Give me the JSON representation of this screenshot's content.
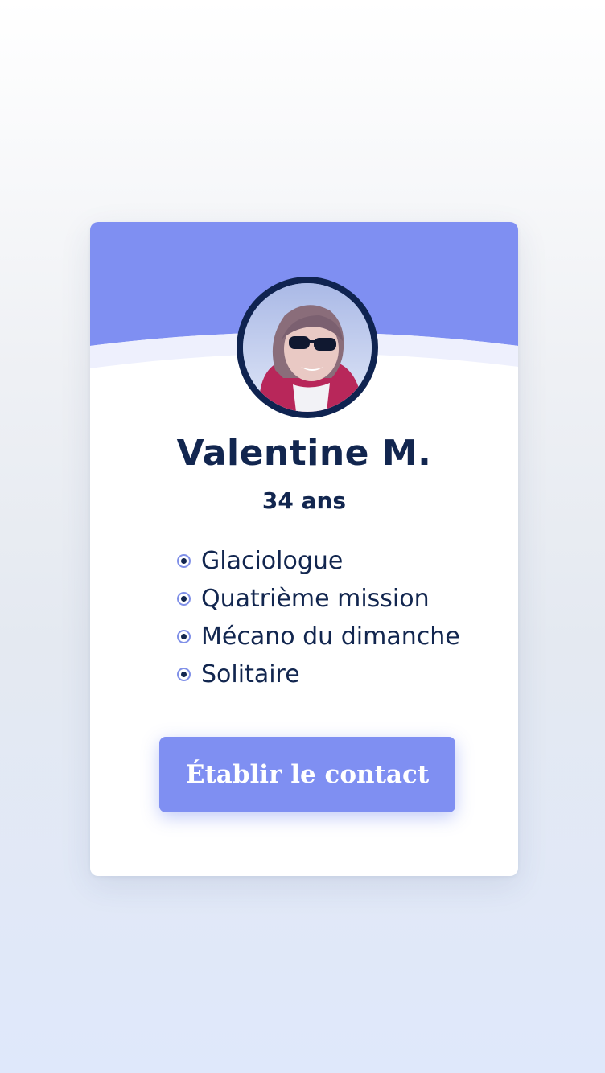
{
  "profile": {
    "name": "Valentine M.",
    "age": "34 ans",
    "traits": [
      "Glaciologue",
      "Quatrième mission",
      "Mécano du dimanche",
      "Solitaire"
    ]
  },
  "actions": {
    "contact_label": "Établir le contact"
  },
  "colors": {
    "accent": "#7f8ff2",
    "text_dark": "#12264f",
    "avatar_border": "#0f2350",
    "card_bg": "#ffffff"
  }
}
